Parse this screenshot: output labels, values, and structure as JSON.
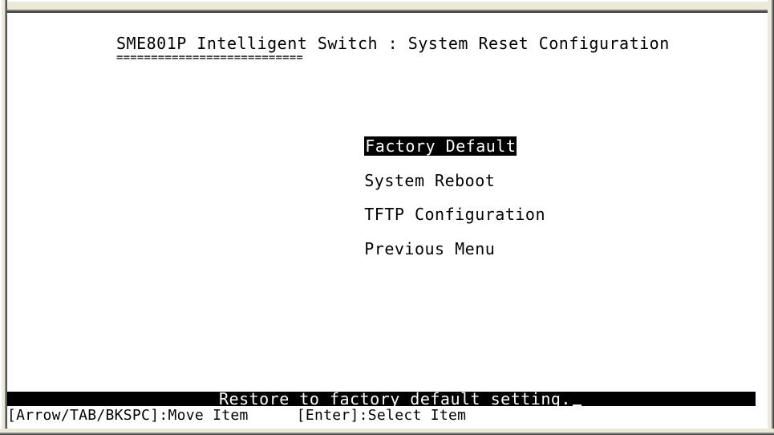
{
  "screen": {
    "title": "SME801P Intelligent Switch : System Reset Configuration",
    "title_underline": "==========================="
  },
  "menu": {
    "items": [
      {
        "label": "Factory Default",
        "selected": true
      },
      {
        "label": "System Reboot",
        "selected": false
      },
      {
        "label": "TFTP Configuration",
        "selected": false
      },
      {
        "label": "Previous Menu",
        "selected": false
      }
    ]
  },
  "status_bar": {
    "text": "Restore to factory default setting."
  },
  "help_line": {
    "move": "[Arrow/TAB/BKSPC]:Move Item",
    "select": "[Enter]:Select Item"
  },
  "colors": {
    "background": "#ffffff",
    "text": "#000000",
    "highlight_bg": "#000000",
    "highlight_text": "#ffffff",
    "window_frame": "#ece9d8"
  }
}
